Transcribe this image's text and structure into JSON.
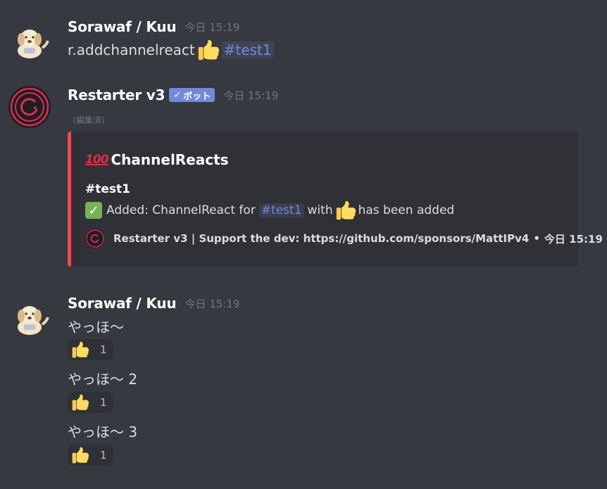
{
  "messages": [
    {
      "author": "Sorawaf / Kuu",
      "timestamp": "今日 15:19",
      "content_prefix": "r.addchannelreact",
      "emoji": "thumbs-up",
      "channel_mention": "#test1"
    },
    {
      "author": "Restarter v3",
      "bot_tag": "ボット",
      "bot_check": "✓",
      "timestamp": "今日 15:19",
      "edited": "（編集済）",
      "embed": {
        "accent_color": "#e74c5b",
        "title_emoji": "100",
        "title": "ChannelReacts",
        "field_name": "#test1",
        "field_check": "✓",
        "field_text_before": "Added: ChannelReact for",
        "field_mention": "#test1",
        "field_text_with": "with",
        "field_text_after": "has been added",
        "footer_text": "Restarter v3 | Support the dev: https://github.com/sponsors/MattIPv4",
        "footer_separator": "•",
        "footer_timestamp": "今日 15:19"
      }
    },
    {
      "author": "Sorawaf / Kuu",
      "timestamp": "今日 15:19",
      "lines": [
        {
          "text": "やっほ～",
          "reaction_count": "1"
        },
        {
          "text": "やっほ～ 2",
          "reaction_count": "1"
        },
        {
          "text": "やっほ～ 3",
          "reaction_count": "1"
        }
      ]
    }
  ],
  "colors": {
    "background": "#36393f",
    "embed_background": "#2f3136",
    "mention": "#7289da",
    "bot_tag": "#7289da",
    "timestamp": "#72767d"
  }
}
